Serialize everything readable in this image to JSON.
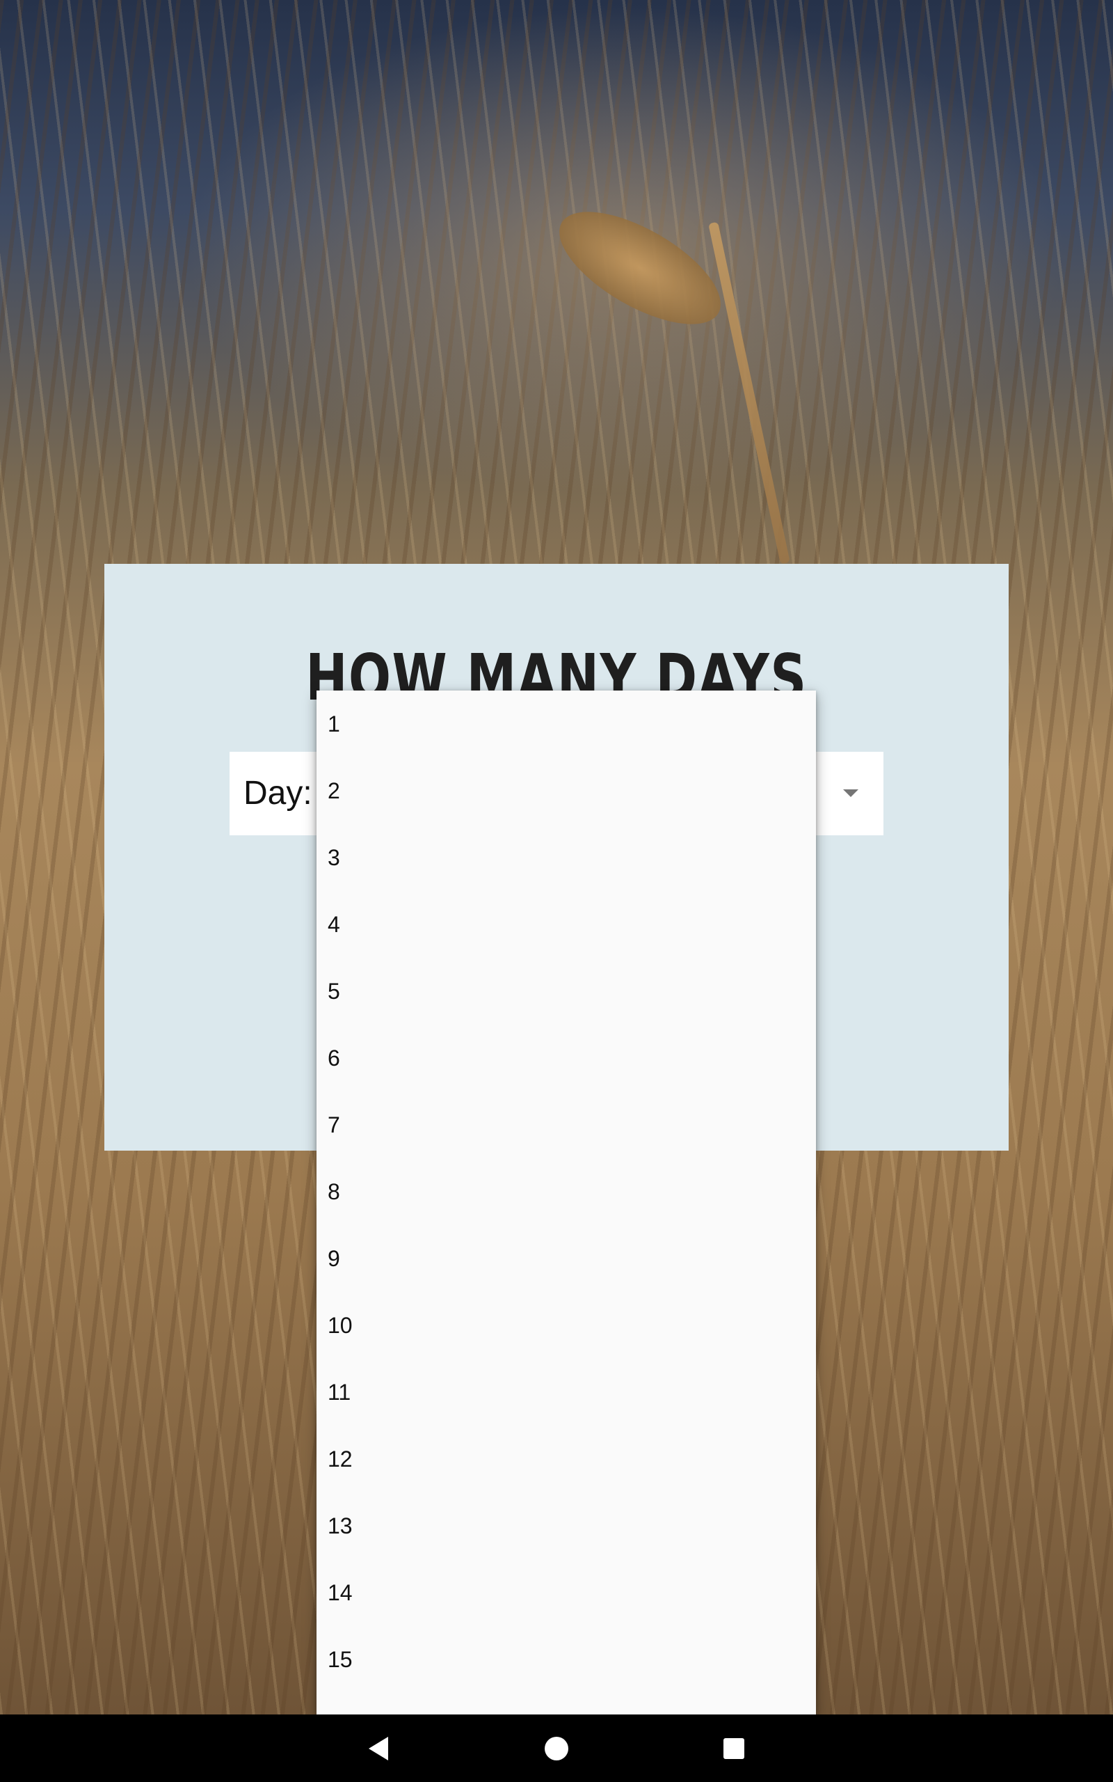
{
  "card": {
    "title": "HOW MANY DAYS",
    "day_label": "Day:"
  },
  "dropdown": {
    "options": [
      "1",
      "2",
      "3",
      "4",
      "5",
      "6",
      "7",
      "8",
      "9",
      "10",
      "11",
      "12",
      "13",
      "14",
      "15"
    ]
  },
  "icons": {
    "dropdown_arrow": "chevron-down-icon",
    "nav_back": "back-icon",
    "nav_home": "home-icon",
    "nav_recents": "recents-icon"
  },
  "colors": {
    "card_background": "#dbe8ed",
    "dropdown_background": "#fafafa",
    "nav_bar": "#000000"
  }
}
